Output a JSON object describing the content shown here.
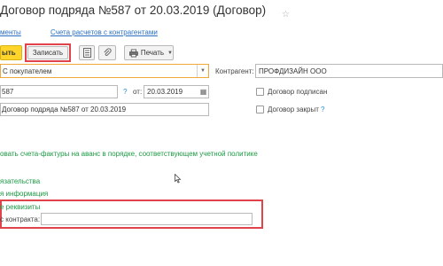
{
  "window": {
    "title": "Договор подряда №587 от 20.03.2019 (Договор)"
  },
  "nav_links": {
    "link1": "менты",
    "link2": "Счета расчетов с контрагентами"
  },
  "toolbar": {
    "close_label": "ыть",
    "save_label": "Записать",
    "print_label": "Печать"
  },
  "form": {
    "contract_type_value": "С покупателем",
    "counterparty_label": "Контрагент:",
    "counterparty_value": "ПРОФДИЗАЙН ООО",
    "number_value": "587",
    "date_prefix": "от:",
    "date_value": "20.03.2019",
    "signed_label": "Договор подписан",
    "name_value": "Договор подряда №587 от 20.03.2019",
    "closed_label": "Договор закрыт",
    "help_mark": "?"
  },
  "sections": {
    "invoice_option": "овать счета-фактуры на аванс в порядке, соответствующем учетной политике",
    "obligations": "язательства",
    "info": "я информация",
    "extra_details": "е реквизиты",
    "contract_label": "с контракта:",
    "contract_value": ""
  },
  "colors": {
    "accent_yellow": "#ffd42b",
    "highlight_red": "#e0434b",
    "link_blue": "#2a6fc2",
    "section_green": "#1c9a43"
  }
}
